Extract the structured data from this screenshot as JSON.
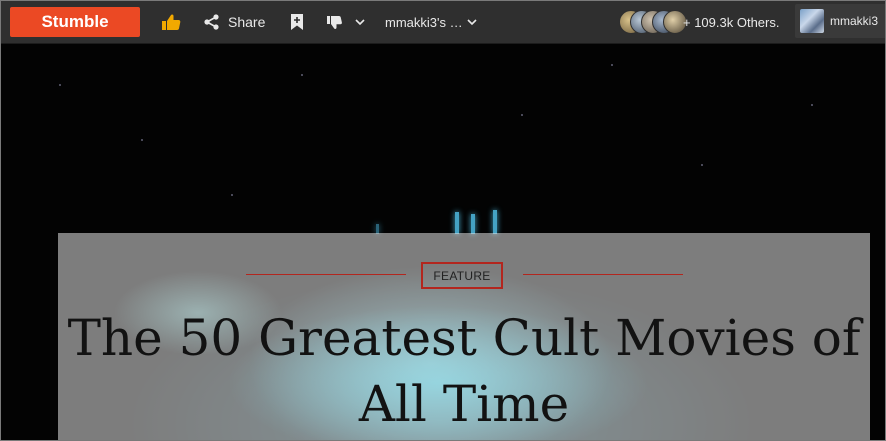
{
  "toolbar": {
    "stumble_label": "Stumble",
    "share_label": "Share",
    "list_label": "mmakki3's …",
    "others_label": "+ 109.3k Others.",
    "user_name": "mmakki3"
  },
  "icons": {
    "like": "thumbs-up-icon",
    "share": "share-icon",
    "save": "bookmark-icon",
    "dislike": "thumbs-down-icon",
    "caret": "chevron-down-icon"
  },
  "colors": {
    "accent": "#eb4924",
    "toolbar_bg": "#2f2f2f",
    "feature_red": "#b3261e"
  },
  "article": {
    "category": "FEATURE",
    "title": "The 50 Greatest Cult Movies of All Time"
  }
}
